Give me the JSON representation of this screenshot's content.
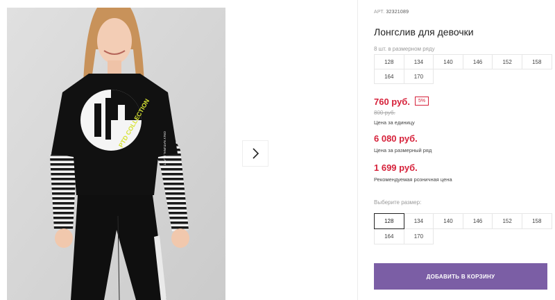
{
  "product": {
    "article_label": "АРТ.",
    "article": "32321089",
    "title": "Лонгслив для девочки",
    "photo_print_text": "PTD COLLECTION",
    "photo_sleeve_text": "ONLY NATURAL PLAYT"
  },
  "pack": {
    "label": "8 шт. в размерном ряду",
    "sizes": [
      "128",
      "134",
      "140",
      "146",
      "152",
      "158",
      "164",
      "170"
    ]
  },
  "prices": {
    "unit_price": "760 руб.",
    "discount": "5%",
    "old_price": "800 руб.",
    "unit_caption": "Цена за единицу",
    "pack_price": "6 080 руб.",
    "pack_caption": "Цена за размерный ряд",
    "retail_price": "1 699 руб.",
    "retail_caption": "Рекомендуемая розничная цена"
  },
  "size_select": {
    "label": "Выберите размер:",
    "selected": "128",
    "options": [
      "128",
      "134",
      "140",
      "146",
      "152",
      "158",
      "164",
      "170"
    ]
  },
  "cart": {
    "add_label": "ДОБАВИТЬ В КОРЗИНУ"
  },
  "colors": {
    "price_red": "#d6213a",
    "button_purple": "#7b5ea5"
  },
  "icons": {
    "next": "chevron-right-icon"
  }
}
